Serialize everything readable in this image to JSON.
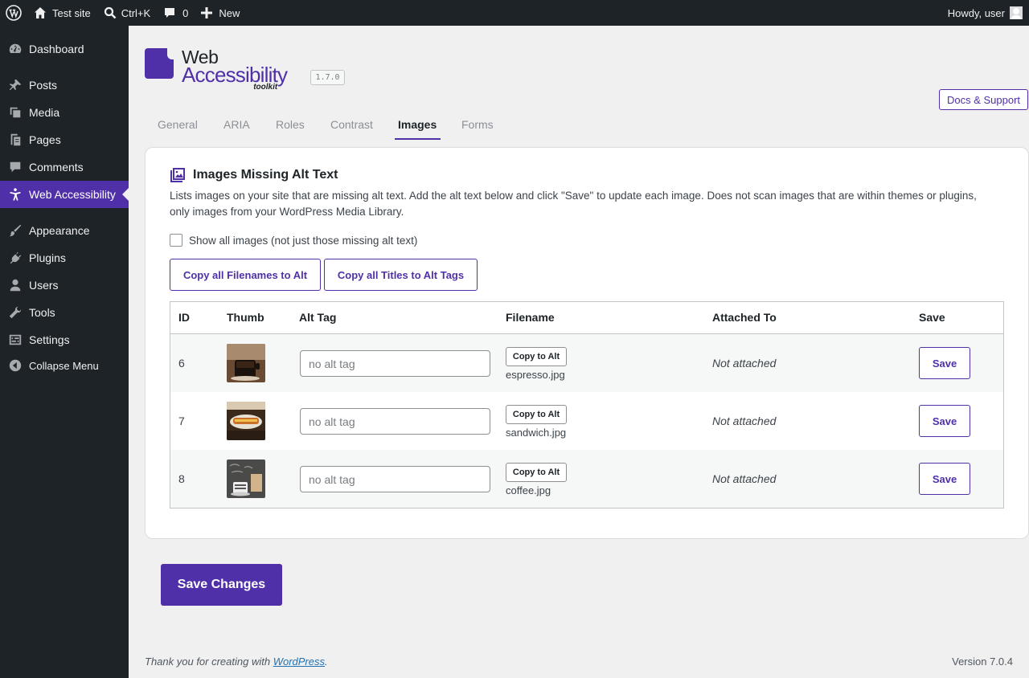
{
  "adminbar": {
    "site_name": "Test site",
    "search_shortcut": "Ctrl+K",
    "comments_count": "0",
    "new_label": "New",
    "howdy": "Howdy, user"
  },
  "sidebar": {
    "items": [
      {
        "label": "Dashboard",
        "icon": "dashboard-icon"
      },
      {
        "label": "Posts",
        "icon": "pin-icon"
      },
      {
        "label": "Media",
        "icon": "media-icon"
      },
      {
        "label": "Pages",
        "icon": "pages-icon"
      },
      {
        "label": "Comments",
        "icon": "comment-icon"
      },
      {
        "label": "Web Accessibility",
        "icon": "accessibility-icon",
        "current": true
      },
      {
        "label": "Appearance",
        "icon": "brush-icon"
      },
      {
        "label": "Plugins",
        "icon": "plugin-icon"
      },
      {
        "label": "Users",
        "icon": "user-icon"
      },
      {
        "label": "Tools",
        "icon": "wrench-icon"
      },
      {
        "label": "Settings",
        "icon": "settings-icon"
      }
    ],
    "collapse_label": "Collapse Menu"
  },
  "brand": {
    "line1": "Web",
    "line2": "Accessibility",
    "line3": "toolkit",
    "version": "1.7.0",
    "accent_color": "#5030a8"
  },
  "docs_button": "Docs & Support",
  "tabs": [
    "General",
    "ARIA",
    "Roles",
    "Contrast",
    "Images",
    "Forms"
  ],
  "active_tab": "Images",
  "panel": {
    "title": "Images Missing Alt Text",
    "description": "Lists images on your site that are missing alt text. Add the alt text below and click \"Save\" to update each image. Does not scan images that are within themes or plugins, only images from your WordPress Media Library.",
    "show_all_label": "Show all images (not just those missing alt text)",
    "show_all_checked": false,
    "copy_filenames_btn": "Copy all Filenames to Alt",
    "copy_titles_btn": "Copy all Titles to Alt Tags"
  },
  "table": {
    "headers": {
      "id": "ID",
      "thumb": "Thumb",
      "alt": "Alt Tag",
      "filename": "Filename",
      "attached": "Attached To",
      "save": "Save"
    },
    "rows": [
      {
        "id": "6",
        "alt_placeholder": "no alt tag",
        "copy_label": "Copy to Alt",
        "filename": "espresso.jpg",
        "attached": "Not attached",
        "save_label": "Save"
      },
      {
        "id": "7",
        "alt_placeholder": "no alt tag",
        "copy_label": "Copy to Alt",
        "filename": "sandwich.jpg",
        "attached": "Not attached",
        "save_label": "Save"
      },
      {
        "id": "8",
        "alt_placeholder": "no alt tag",
        "copy_label": "Copy to Alt",
        "filename": "coffee.jpg",
        "attached": "Not attached",
        "save_label": "Save"
      }
    ]
  },
  "save_changes": "Save Changes",
  "footer": {
    "thanks_prefix": "Thank you for creating with ",
    "thanks_link": "WordPress",
    "thanks_suffix": ".",
    "version": "Version 7.0.4"
  }
}
